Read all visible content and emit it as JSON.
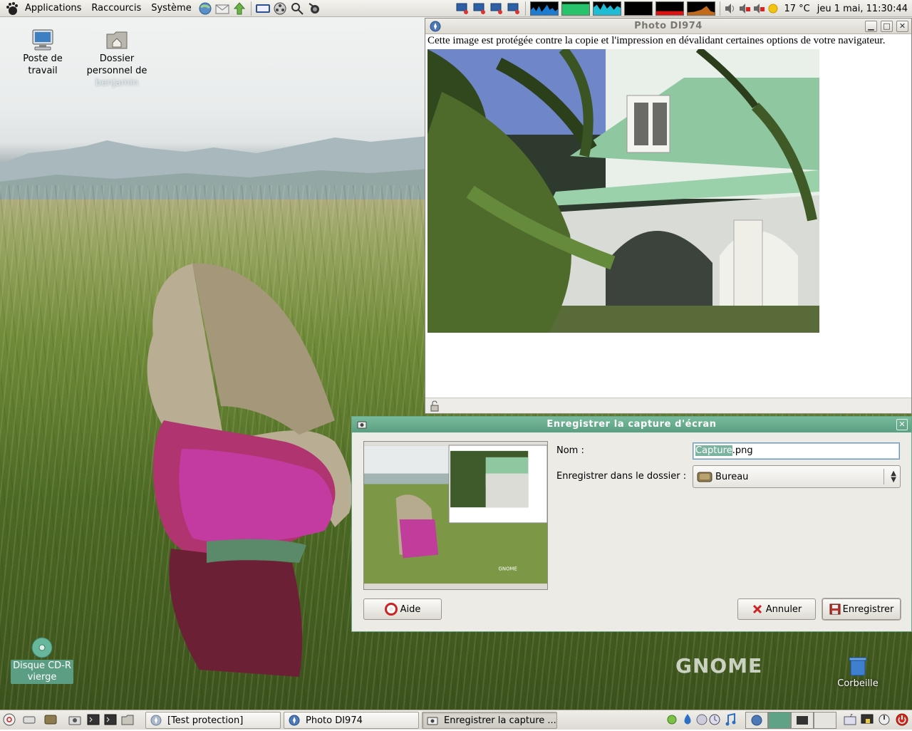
{
  "top_panel": {
    "menus": [
      "Applications",
      "Raccourcis",
      "Système"
    ],
    "weather": "17 °C",
    "datetime": "jeu   1 mai, 11:30:44"
  },
  "desktop": {
    "icons": [
      {
        "label_line1": "Poste de",
        "label_line2": "travail"
      },
      {
        "label_line1": "Dossier",
        "label_line2": "personnel de",
        "label_line3": "benjamin"
      },
      {
        "label_line1": "Disque CD-R",
        "label_line2": "vierge"
      },
      {
        "label_line1": "Corbeille"
      }
    ],
    "watermark": "GNOME"
  },
  "photo_window": {
    "title": "Photo DI974",
    "notice": "Cette image est protégée contre la copie et l'impression en dévalidant certaines options de votre navigateur."
  },
  "save_dialog": {
    "title": "Enregistrer la capture d'écran",
    "name_label": "Nom :",
    "name_selected": "Capture",
    "name_rest": ".png",
    "folder_label": "Enregistrer dans le dossier :",
    "folder_value": "Bureau",
    "help_button": "Aide",
    "cancel_button": "Annuler",
    "save_button": "Enregistrer"
  },
  "taskbar": {
    "tasks": [
      "[Test protection]",
      "Photo DI974",
      "Enregistrer la capture ..."
    ]
  },
  "colors": {
    "dialog_titlebar": "#5a9f80",
    "selection": "#7ab3a0",
    "panel": "#e0ded8"
  }
}
